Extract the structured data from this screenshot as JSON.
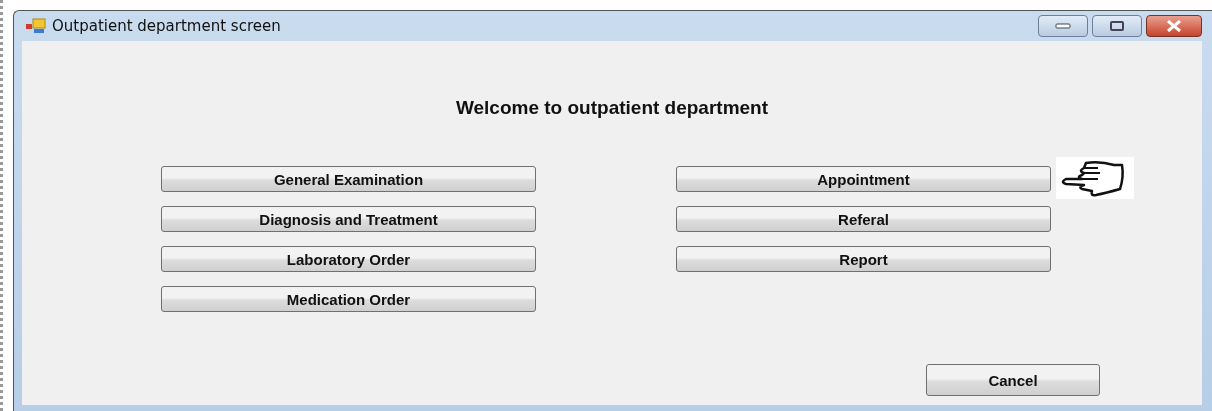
{
  "window": {
    "title": "Outpatient department screen"
  },
  "heading": "Welcome to outpatient department",
  "left_buttons": [
    "General Examination",
    "Diagnosis and Treatment",
    "Laboratory Order",
    "Medication Order"
  ],
  "right_buttons": [
    "Appointment",
    "Referal",
    "Report"
  ],
  "cancel_button": "Cancel"
}
